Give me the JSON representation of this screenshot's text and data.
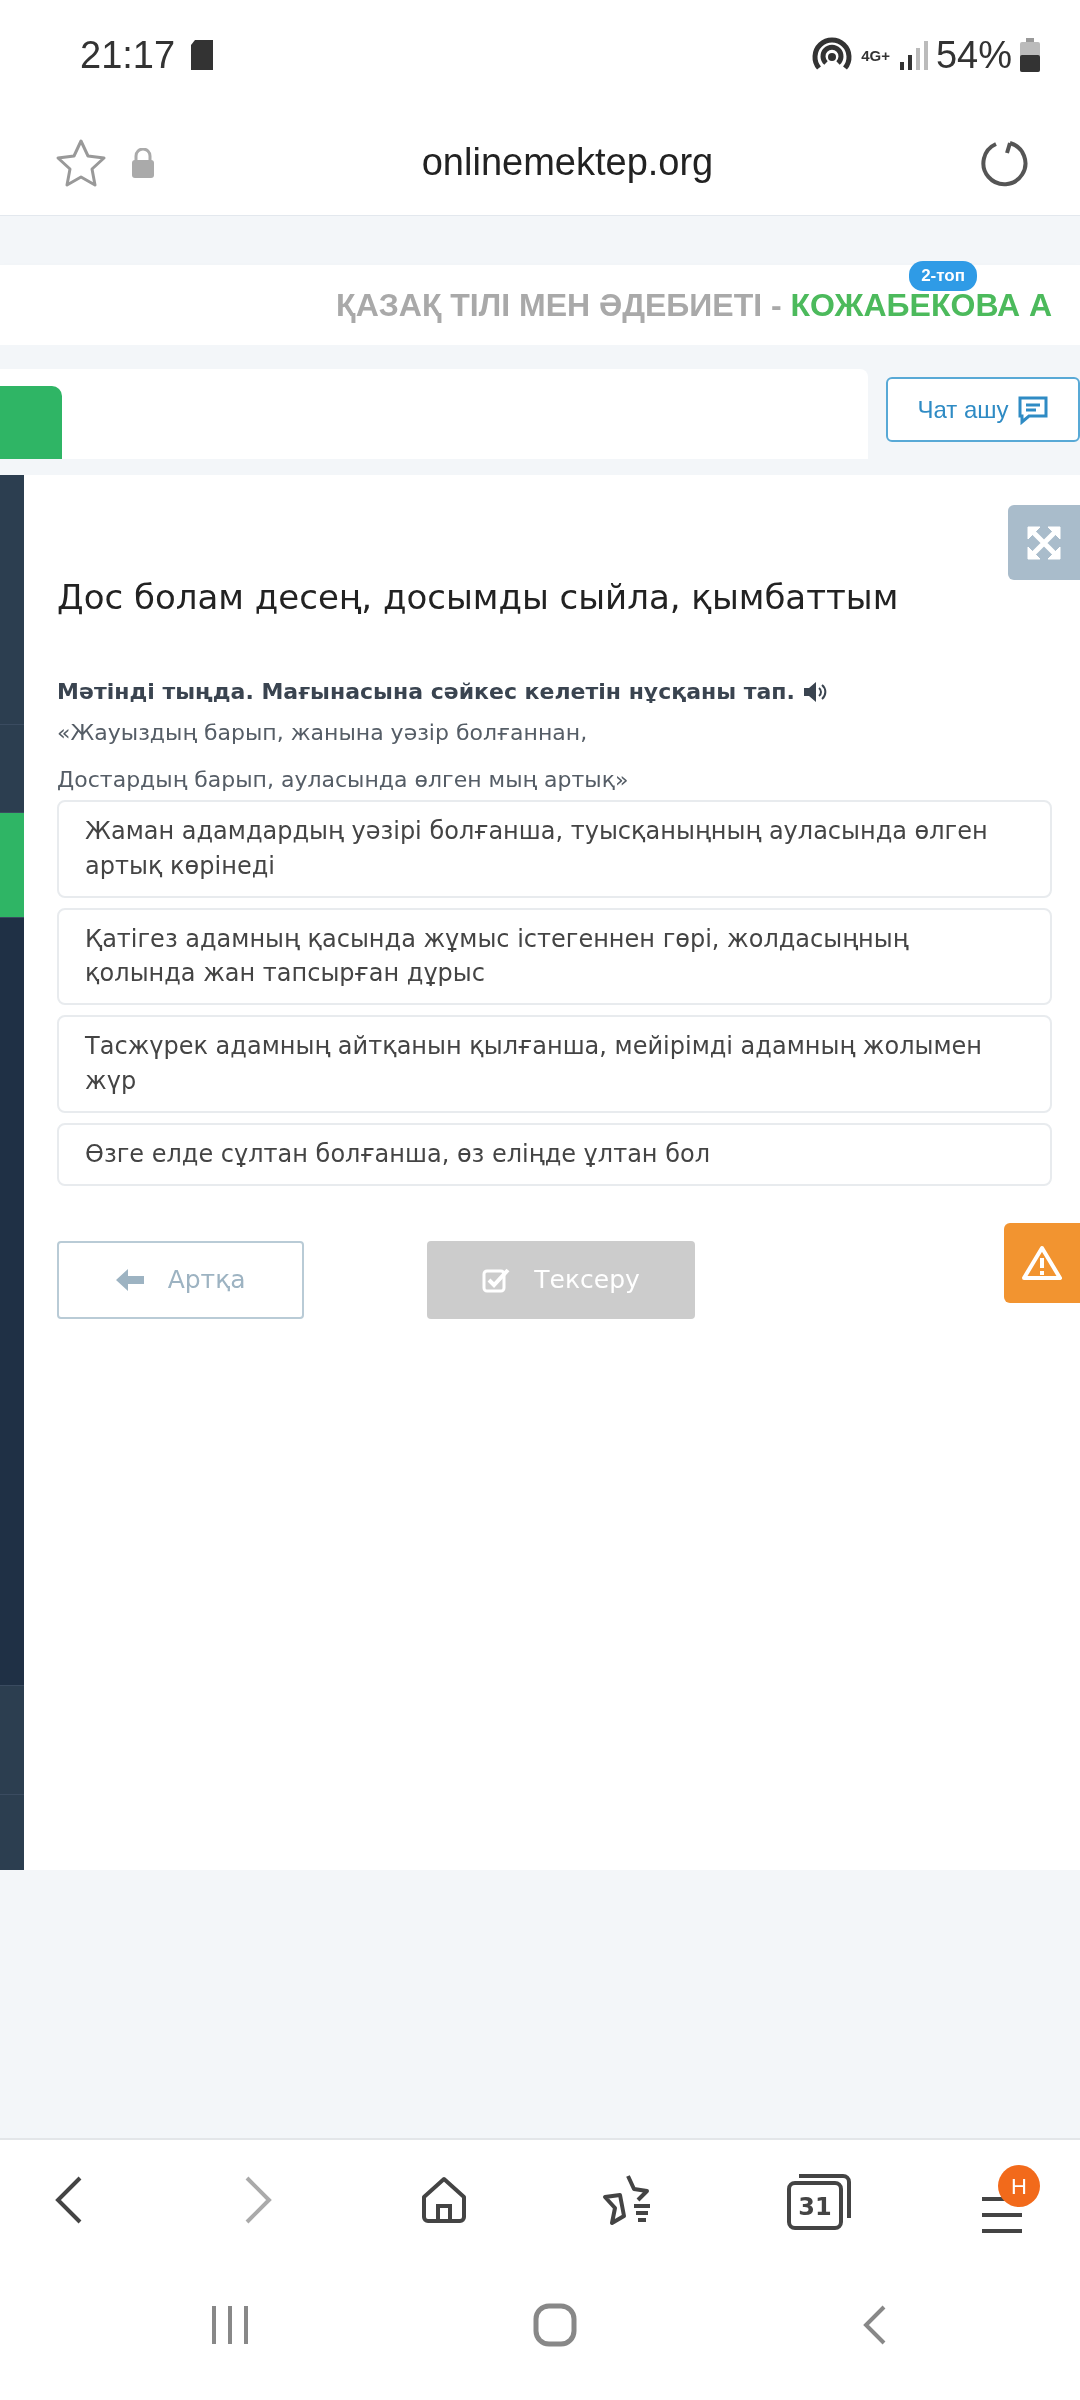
{
  "status_bar": {
    "time": "21:17",
    "network": "4G+",
    "battery": "54%"
  },
  "browser": {
    "url": "onlinemektep.org",
    "nav_badge": "Н",
    "tabs_count": "31"
  },
  "header": {
    "subject": "ҚАЗАҚ ТІЛІ МЕН ӘДЕБИЕТІ - ",
    "teacher": "КОЖАБЕКОВА А",
    "group_badge": "2-топ"
  },
  "chat_button": "Чат ашу",
  "lesson": {
    "title": "Дос болам десең, досымды сыйла, қымбаттым",
    "instruction": "Мәтінді тыңда. Мағынасына сәйкес келетін нұсқаны тап.",
    "quote_lines": [
      "«Жауыздың барып, жанына уәзір болғаннан,",
      "Достардың барып, ауласында өлген мың артық»"
    ],
    "options": [
      {
        "text": "Жаман адамдардың уәзірі болғанша, туысқаныңның ауласында өлген артық көрінеді",
        "selected": false
      },
      {
        "text": "Қатігез адамның қасында жұмыс істегеннен гөрі, жолдасыңның қолында жан тапсырған дұрыс",
        "selected": false
      },
      {
        "text": "Тасжүрек адамның айтқанын қылғанша, мейірімді адамның жолымен жүр",
        "selected": false
      },
      {
        "text": "Өзге елде сұлтан болғанша, өз еліңде ұлтан бол",
        "selected": false
      }
    ]
  },
  "back_button": {
    "label": "Артқа",
    "disabled": false
  },
  "check_button": {
    "label": "Тексеру",
    "disabled": true
  }
}
